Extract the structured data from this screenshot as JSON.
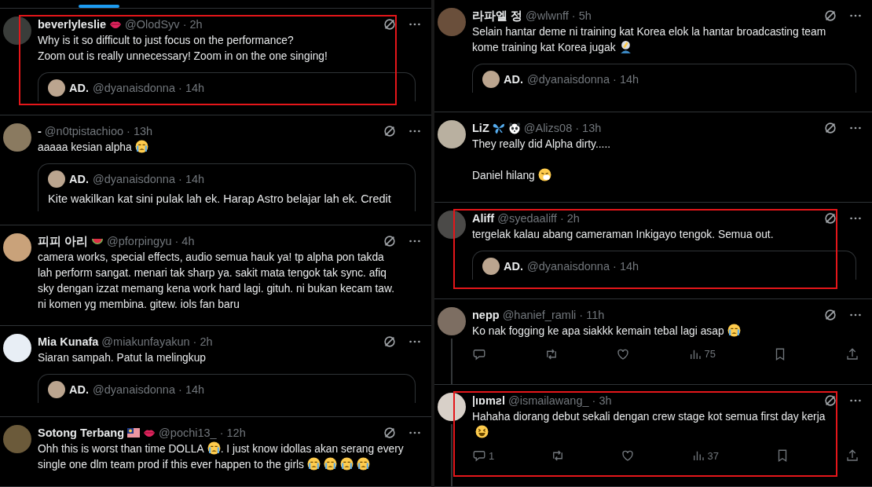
{
  "columns": [
    {
      "tab_indicator": true,
      "tweets": [
        {
          "name": "beverlyleslie",
          "name_icons": [
            {
              "kind": "lips"
            }
          ],
          "meta": "@OlodSyv · 2h",
          "highlighted": true,
          "body": [
            [
              {
                "kind": "text",
                "text": "Why is it so difficult to just focus on the performance?"
              }
            ],
            [
              {
                "kind": "text",
                "text": "Zoom out is really unnecessary! Zoom in on the one singing!"
              }
            ]
          ],
          "quote": {
            "name": "AD.",
            "meta": "@dyanaisdonna · 14h"
          }
        },
        {
          "name": "-",
          "meta": "@n0tpistachioo · 13h",
          "body": [
            [
              {
                "kind": "text",
                "text": "aaaaa kesian alpha"
              },
              {
                "kind": "crying"
              }
            ]
          ],
          "quote": {
            "name": "AD.",
            "meta": "@dyanaisdonna · 14h",
            "text": "Kite wakilkan kat sini pulak lah ek. Harap Astro belajar lah ek. Credit"
          }
        },
        {
          "name": "피피 아리",
          "name_icons": [
            {
              "kind": "watermelon"
            }
          ],
          "meta": "@pforpingyu · 4h",
          "body": [
            [
              {
                "kind": "text",
                "text": "camera works, special effects, audio semua hauk ya! tp alpha pon takda"
              }
            ],
            [
              {
                "kind": "text",
                "text": "lah perform sangat. menari tak sharp ya. sakit mata tengok tak sync. afiq"
              }
            ],
            [
              {
                "kind": "text",
                "text": "sky dengan izzat memang kena work hard lagi. gituh. ni bukan kecam taw."
              }
            ],
            [
              {
                "kind": "text",
                "text": "ni komen yg membina. gitew. iols fan baru"
              }
            ]
          ]
        },
        {
          "name": "Mia Kunafa",
          "meta": "@miakunfayakun · 2h",
          "body": [
            [
              {
                "kind": "text",
                "text": "Siaran sampah. Patut la melingkup"
              }
            ]
          ],
          "quote": {
            "name": "AD.",
            "meta": "@dyanaisdonna · 14h"
          }
        },
        {
          "name": "Sotong Terbang",
          "name_icons": [
            {
              "kind": "flag"
            },
            {
              "kind": "lips"
            }
          ],
          "meta": "@pochi13_ · 12h",
          "body": [
            [
              {
                "kind": "text",
                "text": "Ohh this is worst than time DOLLA"
              },
              {
                "kind": "crying"
              },
              {
                "kind": "text",
                "text": ". I just know idollas akan serang every"
              }
            ],
            [
              {
                "kind": "text",
                "text": "single one dlm team prod if this ever happen to the girls"
              },
              {
                "kind": "crying"
              },
              {
                "kind": "crying"
              },
              {
                "kind": "crying"
              },
              {
                "kind": "crying"
              }
            ]
          ]
        }
      ]
    },
    {
      "tweets": [
        {
          "name": "라파엘 정",
          "meta": "@wlwnff · 5h",
          "body": [
            [
              {
                "kind": "text",
                "text": "Selain hantar deme ni training kat Korea elok la hantar broadcasting team"
              }
            ],
            [
              {
                "kind": "text",
                "text": "kome training kat Korea jugak"
              },
              {
                "kind": "facepalm"
              }
            ]
          ],
          "quote": {
            "name": "AD.",
            "meta": "@dyanaisdonna · 14h"
          }
        },
        {
          "name": "LiZ",
          "name_icons": [
            {
              "kind": "butterfly"
            },
            {
              "kind": "panda"
            }
          ],
          "meta": "@Alizs08 · 13h",
          "body": [
            [
              {
                "kind": "text",
                "text": "They really did Alpha dirty....."
              }
            ],
            [
              {
                "kind": "gap"
              }
            ],
            [
              {
                "kind": "text",
                "text": "Daniel hilang"
              },
              {
                "kind": "sneeze"
              }
            ]
          ]
        },
        {
          "name": "Aliff",
          "meta": "@syedaaliff · 2h",
          "highlighted": true,
          "body": [
            [
              {
                "kind": "text",
                "text": "tergelak kalau abang cameraman Inkigayo tengok. Semua out."
              }
            ]
          ],
          "quote": {
            "name": "AD.",
            "meta": "@dyanaisdonna · 14h"
          }
        },
        {
          "name": "nepp",
          "meta": "@hanief_ramli · 11h",
          "thread": true,
          "body": [
            [
              {
                "kind": "text",
                "text": "Ko nak fogging ke apa siakkk kemain tebal lagi asap"
              },
              {
                "kind": "crying"
              }
            ]
          ],
          "actions": {
            "views": "75"
          }
        },
        {
          "name": "|ıɒmƨl",
          "meta": "@ismailawang_ · 3h",
          "highlighted": true,
          "thread": true,
          "body": [
            [
              {
                "kind": "text",
                "text": "Hahaha diorang debut sekali dengan crew stage kot semua first day kerja"
              }
            ],
            [
              {
                "kind": "laugh"
              }
            ]
          ],
          "actions": {
            "replies": "1",
            "views": "37"
          }
        }
      ]
    }
  ]
}
